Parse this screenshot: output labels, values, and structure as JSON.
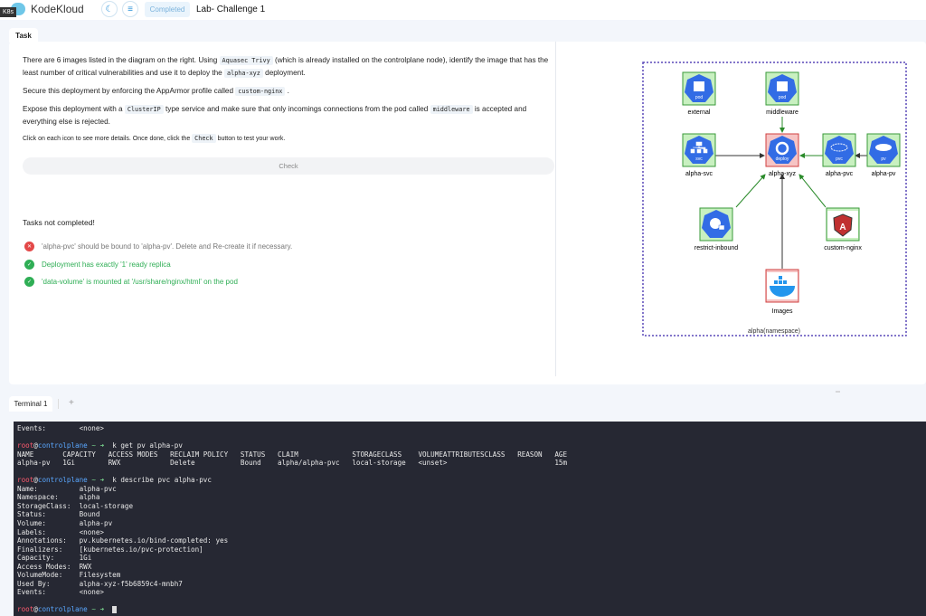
{
  "header": {
    "logo": "KodeKloud",
    "k8s_badge": "K8s",
    "status": "Completed",
    "title": "Lab- Challenge 1",
    "theme_icon": "moon-icon",
    "menu_icon": "list-icon"
  },
  "task_tab": "Task",
  "task": {
    "p1_a": "There are 6 images listed in the diagram on the right. Using ",
    "p1_code1": "Aquasec Trivy",
    "p1_b": " (which is already installed on the controlplane node), identify the image that has the least number of critical vulnerabilities and use it to deploy the ",
    "p1_code2": "alpha-xyz",
    "p1_c": " deployment.",
    "p2_a": "Secure this deployment by enforcing the AppArmor profile called ",
    "p2_code": "custom-nginx",
    "p2_b": " .",
    "p3_a": "Expose this deployment with a ",
    "p3_code1": "ClusterIP",
    "p3_b": " type service and make sure that only incomings connections from the pod called ",
    "p3_code2": "middleware",
    "p3_c": " is accepted and everything else is rejected.",
    "p4_a": "Click on each icon to see more details. Once done, click the ",
    "p4_code": "Check",
    "p4_b": " button to test your work.",
    "check_label": "Check",
    "status": "Tasks not completed!",
    "results": [
      {
        "text": "'alpha-pvc' should be bound to 'alpha-pv'. Delete and Re-create it if necessary.",
        "ok": false
      },
      {
        "text": "Deployment has exactly '1' ready replica",
        "ok": true
      },
      {
        "text": "'data-volume' is mounted at '/usr/share/nginx/html' on the pod",
        "ok": true
      }
    ]
  },
  "diagram": {
    "namespace": "alpha(namespace)",
    "nodes": {
      "external": {
        "label": "external",
        "icon": "pod"
      },
      "middleware": {
        "label": "middleware",
        "icon": "pod"
      },
      "alpha_svc": {
        "label": "alpha-svc",
        "icon": "svc"
      },
      "alpha_xyz": {
        "label": "alpha-xyz",
        "icon": "deploy"
      },
      "alpha_pvc": {
        "label": "alpha-pvc",
        "icon": "pvc"
      },
      "alpha_pv": {
        "label": "alpha-pv",
        "icon": "pv"
      },
      "restrict_inbound": {
        "label": "restrict-inbound"
      },
      "custom_nginx": {
        "label": "custom-nginx"
      },
      "images": {
        "label": "Images"
      }
    },
    "colors": {
      "ok_fill": "#c8f0c0",
      "ok_border": "#3a9a3a",
      "bad_fill": "#f6c4c4",
      "bad_border": "#d04040",
      "k8s_blue": "#326ce5",
      "edge_green": "#2a8a2a"
    }
  },
  "terminal": {
    "tab": "Terminal 1",
    "add": "+",
    "lines": [
      "Events:        <none>",
      "",
      {
        "user": "root",
        "host": "controlplane",
        "cmd": "k get pv alpha-pv"
      },
      "NAME       CAPACITY   ACCESS MODES   RECLAIM POLICY   STATUS   CLAIM             STORAGECLASS    VOLUMEATTRIBUTESCLASS   REASON   AGE",
      "alpha-pv   1Gi        RWX            Delete           Bound    alpha/alpha-pvc   local-storage   <unset>                          15m",
      "",
      {
        "user": "root",
        "host": "controlplane",
        "cmd": "k describe pvc alpha-pvc"
      },
      "Name:          alpha-pvc",
      "Namespace:     alpha",
      "StorageClass:  local-storage",
      "Status:        Bound",
      "Volume:        alpha-pv",
      "Labels:        <none>",
      "Annotations:   pv.kubernetes.io/bind-completed: yes",
      "Finalizers:    [kubernetes.io/pvc-protection]",
      "Capacity:      1Gi",
      "Access Modes:  RWX",
      "VolumeMode:    Filesystem",
      "Used By:       alpha-xyz-f5b6859c4-mnbh7",
      "Events:        <none>",
      "",
      {
        "user": "root",
        "host": "controlplane",
        "cmd": ""
      }
    ]
  }
}
